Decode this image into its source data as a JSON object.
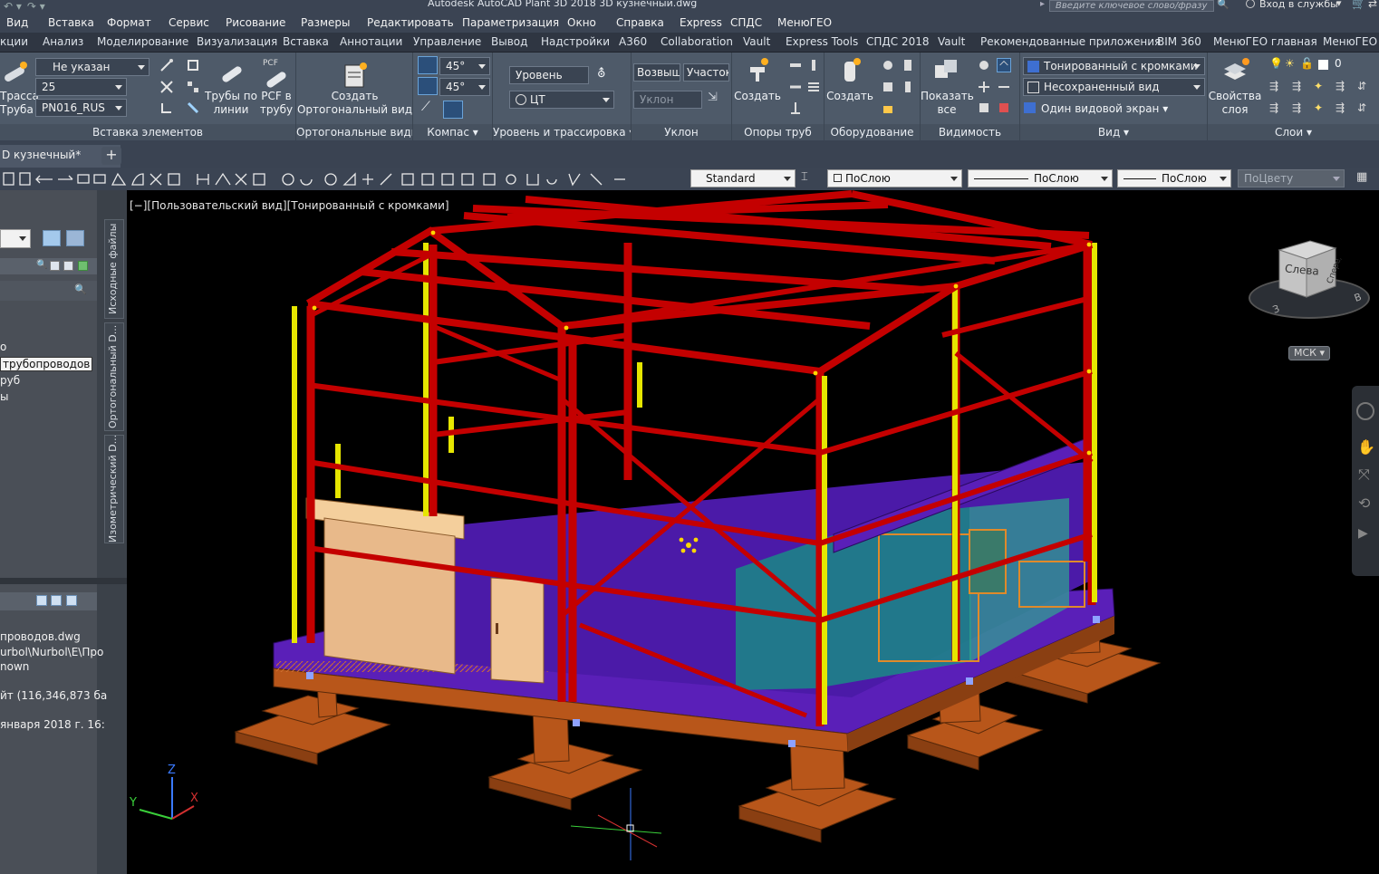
{
  "title": "Autodesk AutoCAD Plant 3D 2018    3D кузнечный.dwg",
  "search_placeholder": "Введите ключевое слово/фразу",
  "sign_in": "Вход в службы",
  "menu": [
    "Вид",
    "Вставка",
    "Формат",
    "Сервис",
    "Рисование",
    "Размеры",
    "Редактировать",
    "Параметризация",
    "Окно",
    "Справка",
    "Express",
    "СПДС",
    "МенюГЕО"
  ],
  "ribbon_tabs": [
    "кции",
    "Анализ",
    "Моделирование",
    "Визуализация",
    "Вставка",
    "Аннотации",
    "Управление",
    "Вывод",
    "Надстройки",
    "A360",
    "Collaboration",
    "Vault",
    "Express Tools",
    "СПДС 2018",
    "Vault",
    "Рекомендованные приложения",
    "BIM 360",
    "МенюГЕО главная",
    "МенюГЕО"
  ],
  "ribbon": {
    "insert_elements": {
      "title": "Вставка элементов",
      "route_label": "Трасса\nТруба",
      "spec": "Не указан",
      "size": "25",
      "spec2": "PN016_RUS",
      "pipes_by_line": "Трубы по\nлинии",
      "pcf_small": "PCF",
      "pcf_to_pipe": "PCF в\nтрубу"
    },
    "ortho": {
      "title": "Ортогональные виды",
      "create": "Создать\nОртогональный вид"
    },
    "compass": {
      "title": "Компас",
      "angle1": "45°",
      "angle2": "45°"
    },
    "level": {
      "title": "Уровень и трассировка",
      "level": "Уровень",
      "ct": "ЦТ"
    },
    "slope": {
      "title": "Уклон",
      "rise": "Возвыш",
      "section": "Участок",
      "slope_field": "Уклон"
    },
    "supports": {
      "title": "Опоры труб",
      "create": "Создать"
    },
    "equipment": {
      "title": "Оборудование",
      "create": "Создать"
    },
    "visibility": {
      "title": "Видимость",
      "show_all": "Показать\nвсе"
    },
    "view": {
      "title": "Вид",
      "visual_style": "Тонированный с кромками",
      "saved_view": "Несохраненный вид",
      "viewport": "Один видовой экран"
    },
    "layers": {
      "title": "Слои",
      "props": "Свойства\nслоя",
      "layer_num": "0"
    }
  },
  "doc_tab": "D кузнечный*",
  "props_toolbar": {
    "style": "Standard",
    "layer": "ПоСлою",
    "linetype": "ПоСлою",
    "lineweight": "ПоСлою",
    "color": "ПоЦвету"
  },
  "palette": {
    "tree": [
      "о",
      "трубопроводов",
      "руб",
      "ы"
    ],
    "details": [
      "проводов.dwg",
      "urbol\\Nurbol\\E\\Про",
      "nown",
      "йт (116,346,873 ба",
      "января 2018 г. 16:"
    ],
    "vtabs": [
      "Исходные файлы",
      "Ортогональный D...",
      "Изометрический D..."
    ]
  },
  "viewport": {
    "label": "[−][Пользовательский вид][Тонированный с кромками]",
    "viewcube_face": "Слева",
    "viewcube_face2": "Спереди",
    "ucs": "МСК",
    "axes": {
      "x": "X",
      "y": "Y",
      "z": "Z"
    },
    "compass": {
      "w": "З",
      "e": "В"
    }
  },
  "colors": {
    "steel": "#c40000",
    "column": "#e6e600",
    "floor": "#4b1aa8",
    "foundation": "#b8561a",
    "wall": "#e8b98a",
    "room": "#6fd3b0"
  }
}
